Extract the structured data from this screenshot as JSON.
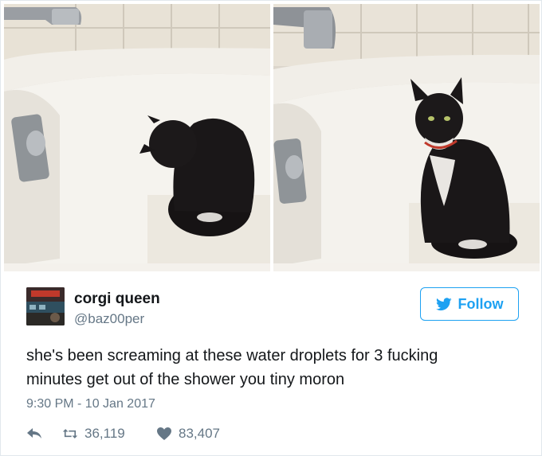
{
  "tweet": {
    "display_name": "corgi queen",
    "handle": "@baz00per",
    "text_line1": "she's been screaming at these water droplets for 3 fucking",
    "text_line2": "minutes get out of the shower you tiny moron",
    "timestamp": "9:30 PM - 10 Jan 2017",
    "retweets": "36,119",
    "likes": "83,407"
  },
  "follow_button": {
    "label": "Follow"
  },
  "icons": {
    "follow": "twitter-bird-icon",
    "reply": "reply-arrow-icon",
    "retweet": "retweet-icon",
    "like": "heart-icon"
  },
  "colors": {
    "accent": "#1da1f2",
    "secondary_text": "#657786",
    "primary_text": "#14171a"
  }
}
